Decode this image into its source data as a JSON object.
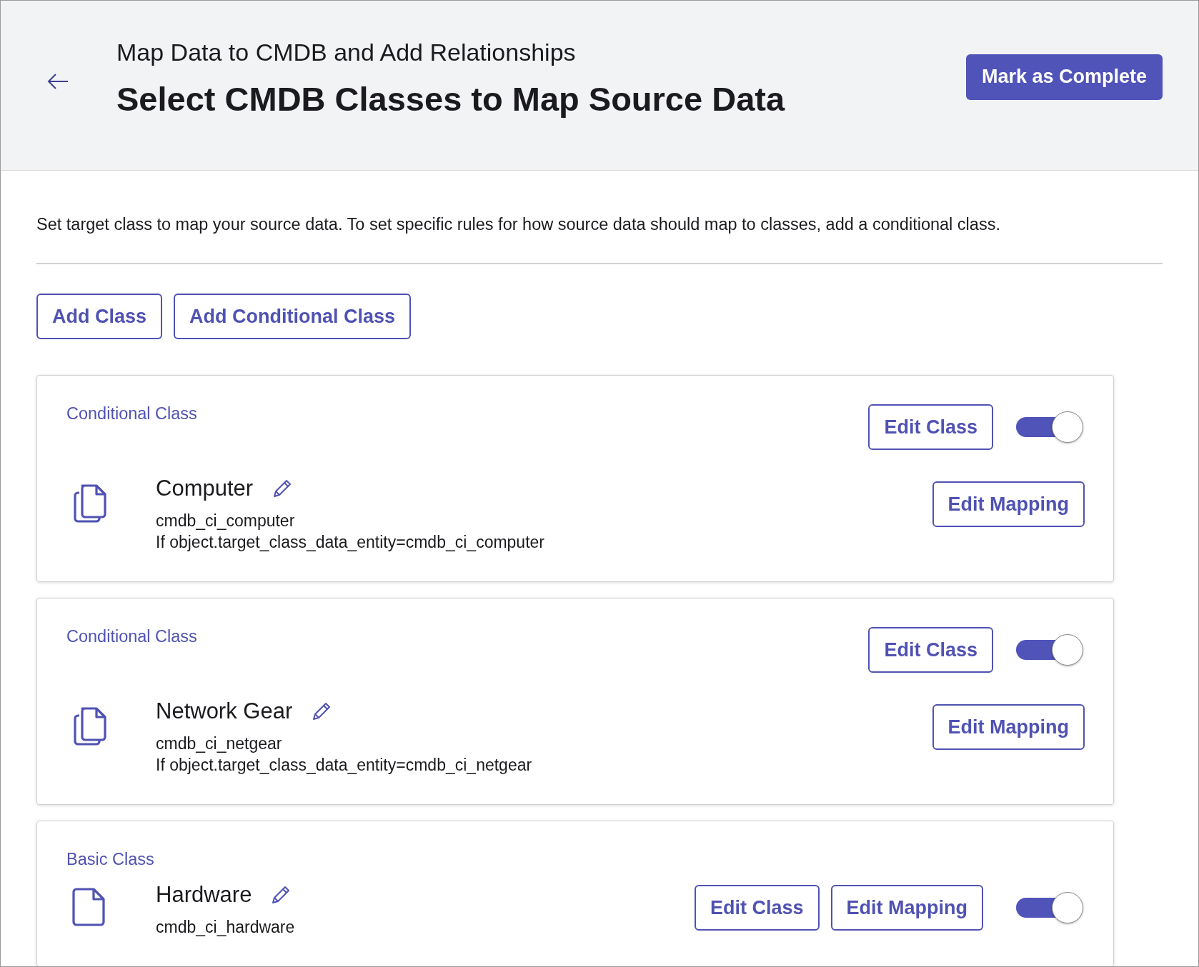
{
  "header": {
    "breadcrumb": "Map Data to CMDB and Add Relationships",
    "title": "Select CMDB Classes to Map Source Data",
    "primary_button": "Mark as Complete"
  },
  "description": "Set target class to map your source data. To set specific rules for how source data should map to classes, add a conditional class.",
  "actions": [
    "Add Class",
    "Add Conditional Class"
  ],
  "classes": [
    {
      "kind": "conditional",
      "type_label": "Conditional Class",
      "name": "Computer",
      "table": "cmdb_ci_computer",
      "condition": "If object.target_class_data_entity=cmdb_ci_computer",
      "edit_class": "Edit Class",
      "edit_mapping": "Edit Mapping",
      "on": true
    },
    {
      "kind": "conditional",
      "type_label": "Conditional Class",
      "name": "Network Gear",
      "table": "cmdb_ci_netgear",
      "condition": "If object.target_class_data_entity=cmdb_ci_netgear",
      "edit_class": "Edit Class",
      "edit_mapping": "Edit Mapping",
      "on": true
    },
    {
      "kind": "basic",
      "type_label": "Basic Class",
      "name": "Hardware",
      "table": "cmdb_ci_hardware",
      "edit_class": "Edit Class",
      "edit_mapping": "Edit Mapping",
      "on": true
    }
  ]
}
